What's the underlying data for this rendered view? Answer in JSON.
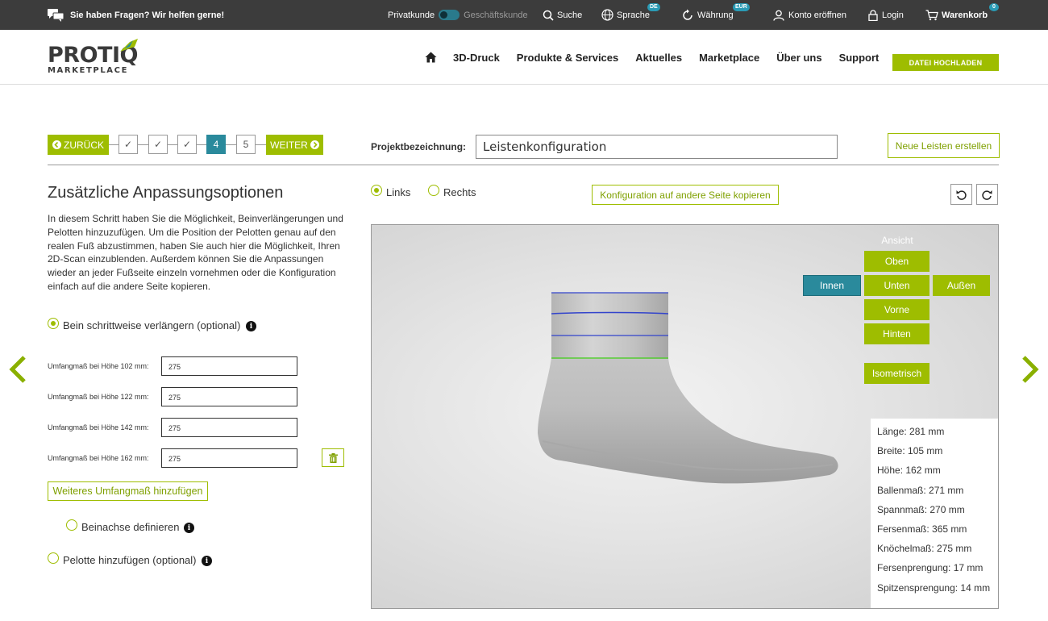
{
  "topbar": {
    "help": "Sie haben Fragen? Wir helfen gerne!",
    "customer_private": "Privatkunde",
    "customer_business": "Geschäftskunde",
    "search": "Suche",
    "language": "Sprache",
    "language_badge": "DE",
    "currency": "Währung",
    "currency_badge": "EUR",
    "register": "Konto eröffnen",
    "login": "Login",
    "cart": "Warenkorb",
    "cart_count": "0"
  },
  "header": {
    "logo_main": "PROTIQ",
    "logo_sub": "MARKETPLACE",
    "nav": [
      "3D-Druck",
      "Produkte & Services",
      "Aktuelles",
      "Marketplace",
      "Über uns",
      "Support"
    ],
    "upload": "DATEI HOCHLADEN"
  },
  "wizard": {
    "back": "ZURÜCK",
    "next": "WEITER",
    "steps": [
      "✓",
      "✓",
      "✓",
      "4",
      "5"
    ],
    "current_step": 4,
    "project_label": "Projektbezeichnung:",
    "project_value": "Leistenkonfiguration",
    "new_button": "Neue Leisten erstellen"
  },
  "left": {
    "title": "Zusätzliche Anpassungsoptionen",
    "description": "In diesem Schritt haben Sie die Möglichkeit, Beinverlängerungen und Pelotten hinzuzufügen. Um die Position der Pelotten genau auf den realen Fuß abzustimmen, haben Sie auch hier die Möglichkeit, Ihren 2D-Scan einzublenden. Außerdem können Sie die Anpassungen wieder an jeder Fußseite einzeln vornehmen oder die Konfiguration einfach auf die andere Seite kopieren.",
    "option_extend": "Bein schrittweise verlängern (optional)",
    "fields": [
      {
        "label": "Umfangmaß bei Höhe  102 mm:",
        "value": "275"
      },
      {
        "label": "Umfangmaß bei Höhe  122 mm:",
        "value": "275"
      },
      {
        "label": "Umfangmaß bei Höhe  142 mm:",
        "value": "275"
      },
      {
        "label": "Umfangmaß bei Höhe  162 mm:",
        "value": "275"
      }
    ],
    "add_measure": "Weiteres Umfangmaß hinzufügen",
    "option_axis": "Beinachse definieren",
    "option_pelotte": "Pelotte hinzufügen (optional)"
  },
  "viewer": {
    "side_left": "Links",
    "side_right": "Rechts",
    "selected_side": "Links",
    "copy_button": "Konfiguration auf andere Seite kopieren",
    "view_title": "Ansicht",
    "views": {
      "top": "Oben",
      "inner": "Innen",
      "bottom": "Unten",
      "outer": "Außen",
      "front": "Vorne",
      "back": "Hinten",
      "iso": "Isometrisch"
    },
    "selected_view": "Innen",
    "measurements": [
      "Länge: 281 mm",
      "Breite: 105 mm",
      "Höhe: 162 mm",
      "Ballenmaß: 271 mm",
      "Spannmaß: 270 mm",
      "Fersenmaß: 365 mm",
      "Knöchelmaß: 275 mm",
      "Fersenprengung: 17 mm",
      "Spitzensprengung: 14 mm"
    ]
  },
  "colors": {
    "accent": "#9ebd00",
    "teal": "#2a8a9c",
    "topbar": "#3c3c3c"
  }
}
